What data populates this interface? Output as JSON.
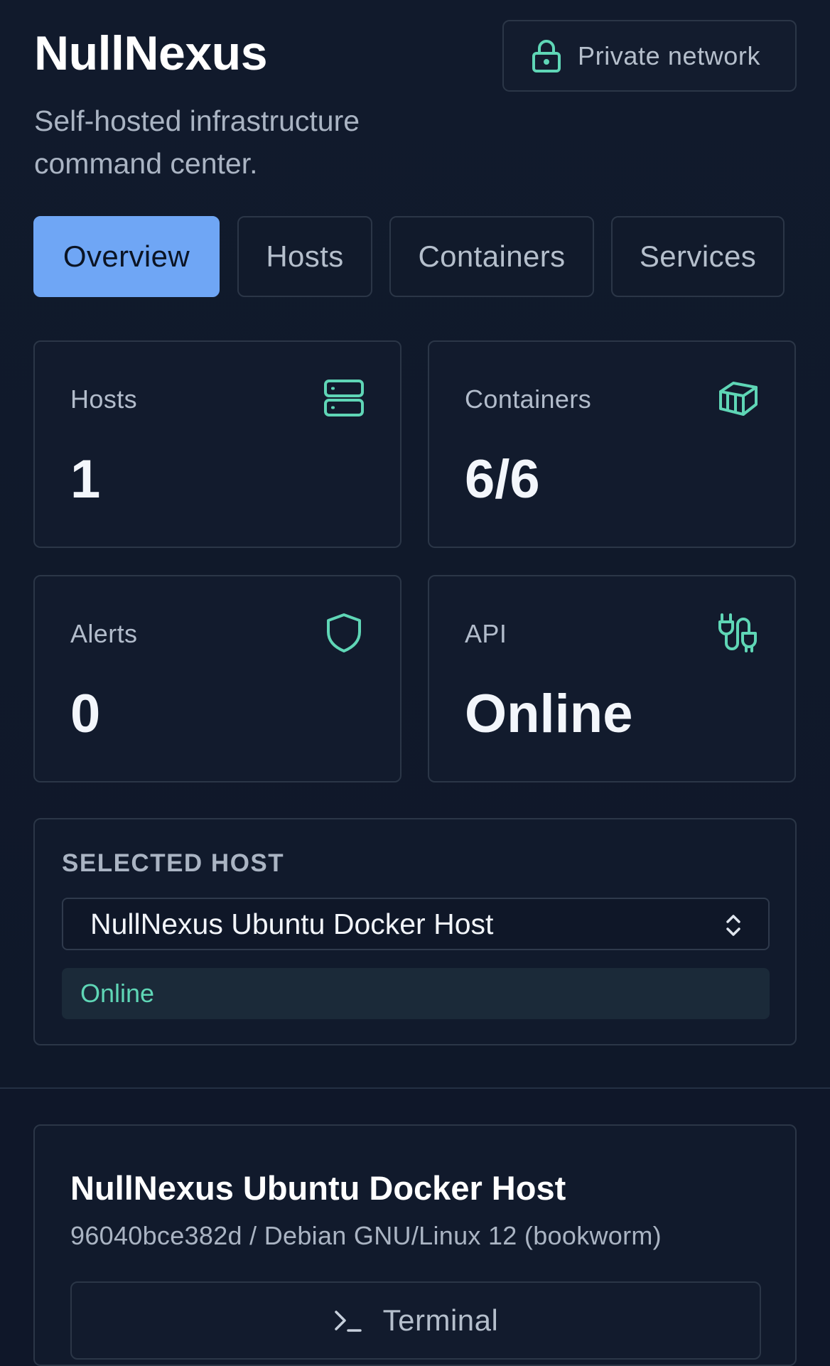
{
  "header": {
    "title": "NullNexus",
    "subtitle": "Self-hosted infrastructure command center.",
    "network_badge": {
      "label": "Private network",
      "icon": "lock-icon"
    }
  },
  "tabs": [
    {
      "label": "Overview",
      "active": true
    },
    {
      "label": "Hosts",
      "active": false
    },
    {
      "label": "Containers",
      "active": false
    },
    {
      "label": "Services",
      "active": false
    }
  ],
  "stats": [
    {
      "label": "Hosts",
      "value": "1",
      "icon": "server-icon"
    },
    {
      "label": "Containers",
      "value": "6/6",
      "icon": "container-box-icon"
    },
    {
      "label": "Alerts",
      "value": "0",
      "icon": "shield-icon"
    },
    {
      "label": "API",
      "value": "Online",
      "icon": "api-plug-icon"
    }
  ],
  "selected_host": {
    "caption": "SELECTED HOST",
    "value": "NullNexus Ubuntu Docker Host",
    "status": "Online"
  },
  "host_detail": {
    "title": "NullNexus Ubuntu Docker Host",
    "subtitle": "96040bce382d / Debian GNU/Linux 12 (bookworm)",
    "terminal_label": "Terminal"
  },
  "colors": {
    "accent": "#6fa6f5",
    "teal": "#5fd6b6",
    "background": "#0f1729",
    "border": "#2b3647"
  }
}
